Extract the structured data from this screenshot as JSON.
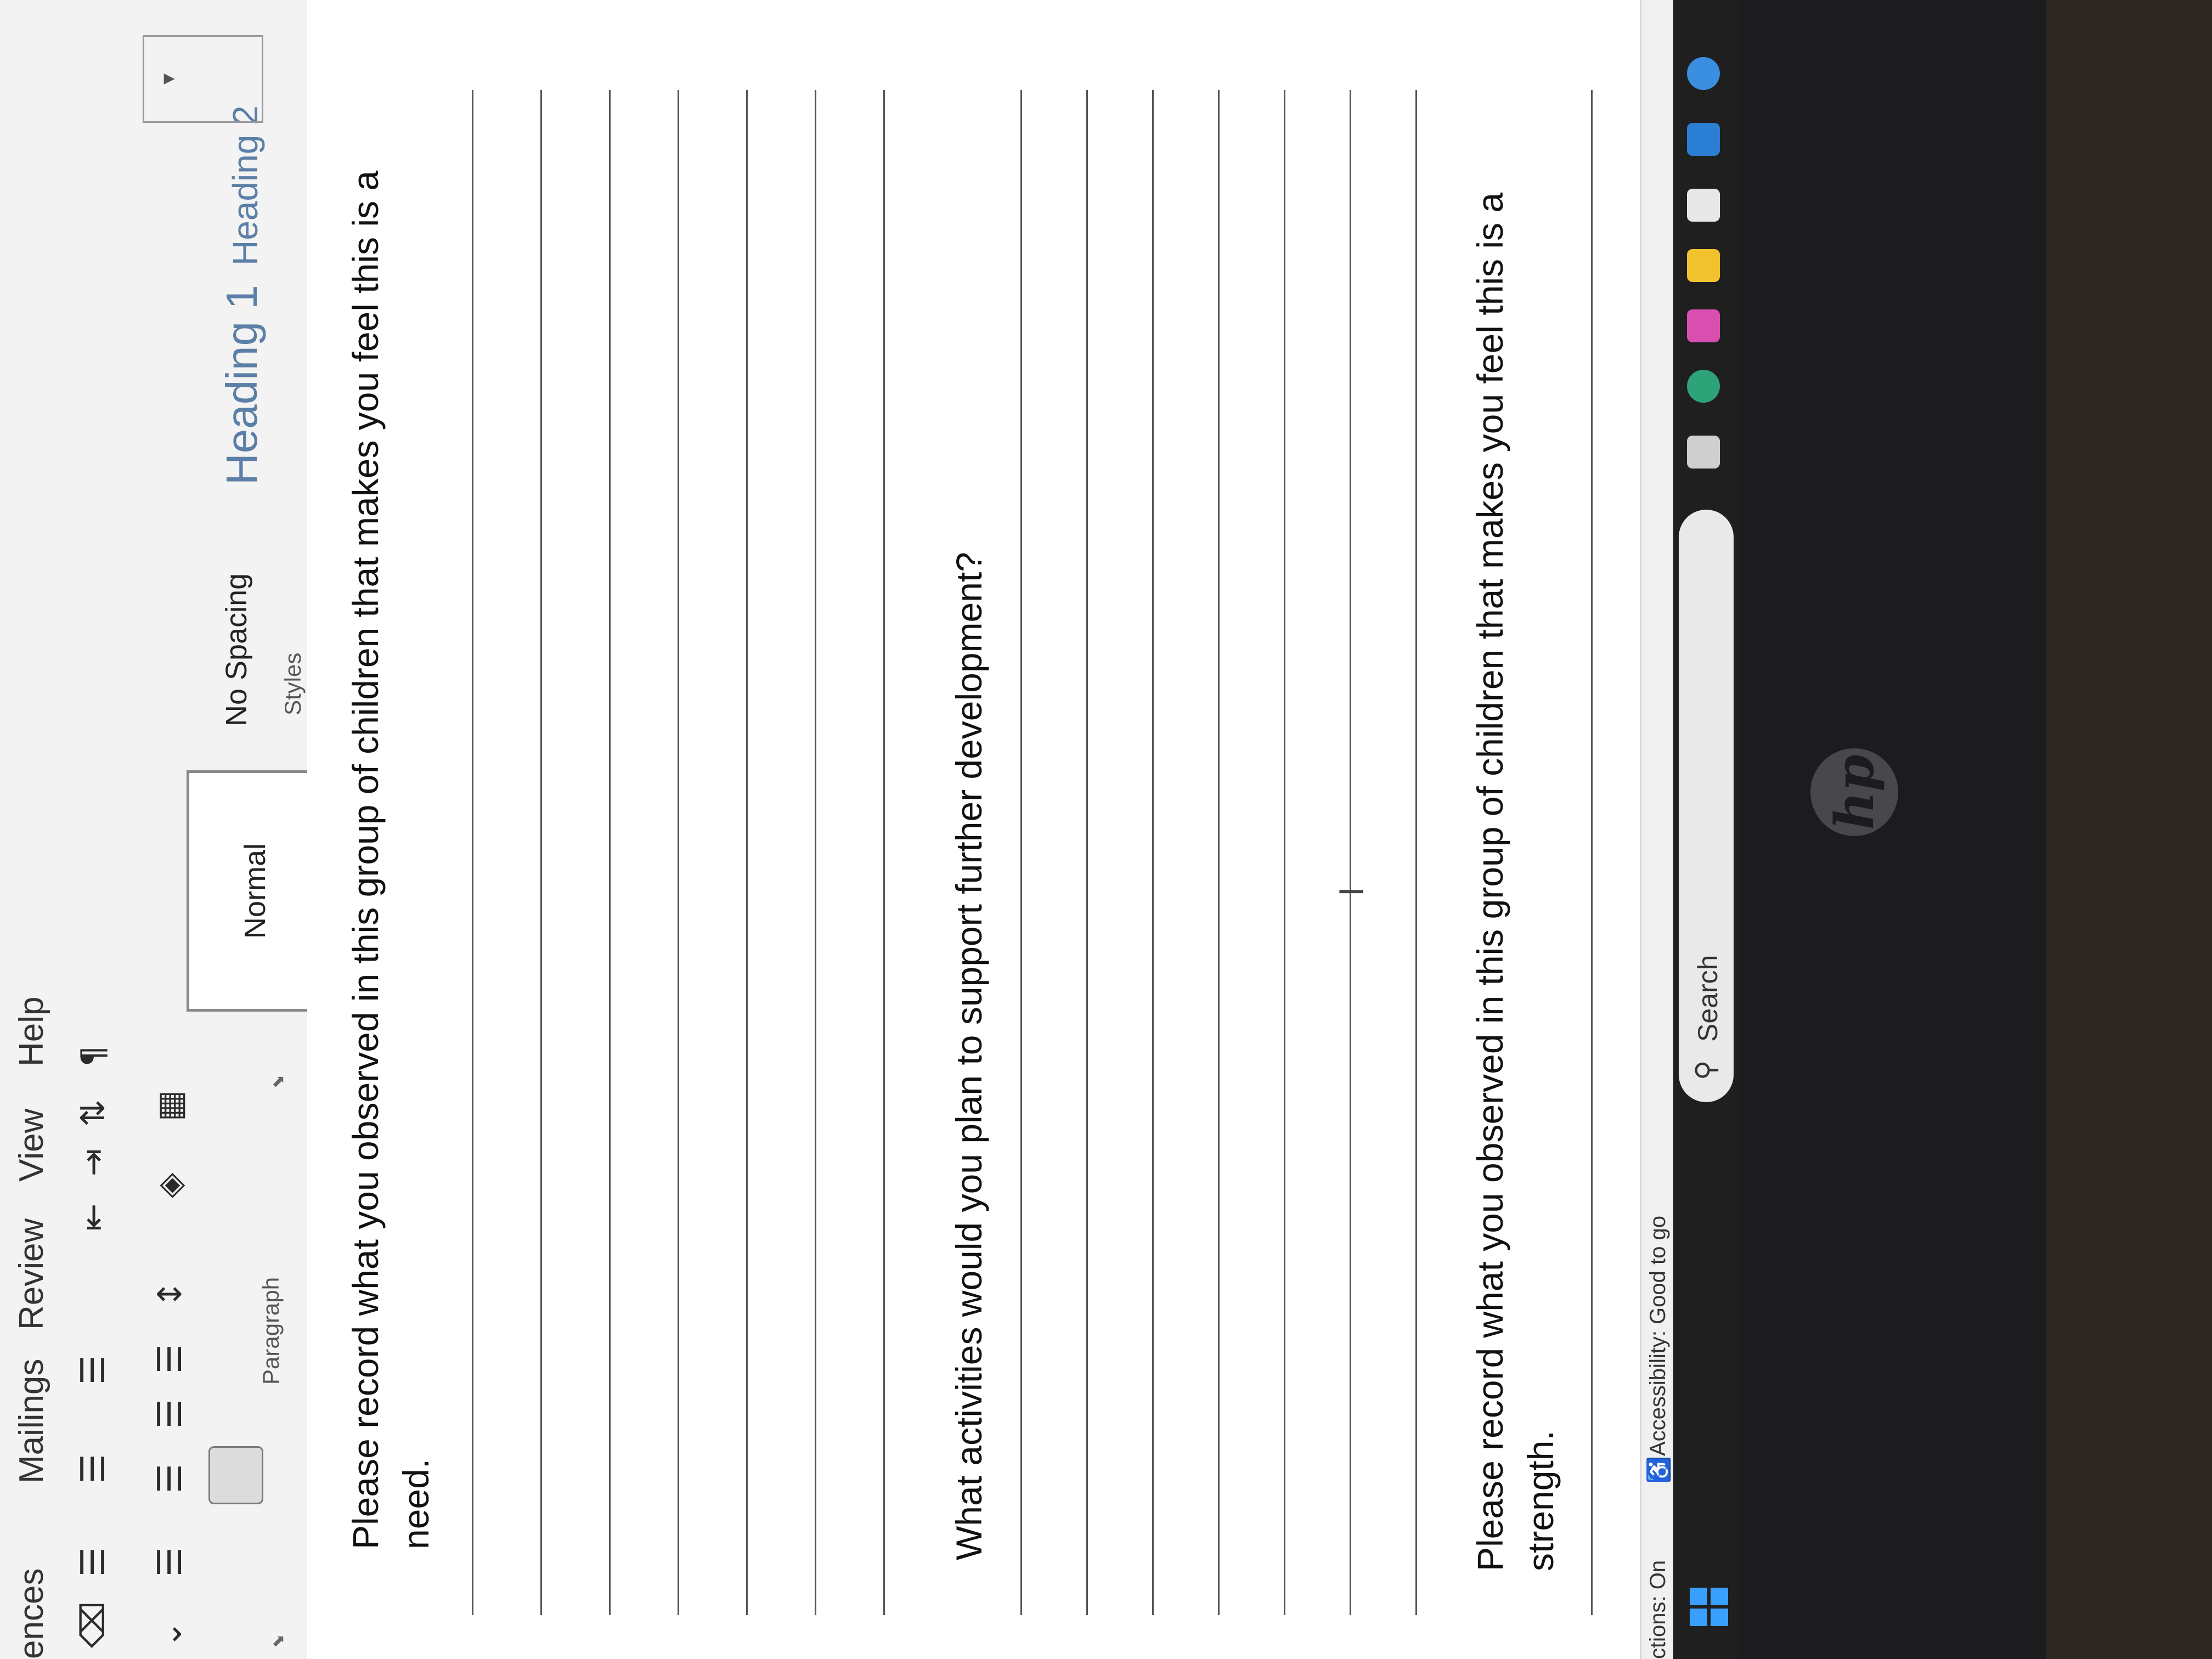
{
  "ribbon": {
    "tabs": [
      "ences",
      "Mailings",
      "Review",
      "View",
      "Help"
    ],
    "groups": {
      "paragraph": "Paragraph",
      "styles": "Styles"
    },
    "styles": {
      "normal": "Normal",
      "no_spacing": "No Spacing",
      "heading1": "Heading 1",
      "heading2": "Heading 2"
    },
    "heading_color": "#5b7fa6"
  },
  "document": {
    "q1_line1": "Please record what you observed in this group of children that makes you feel this is a",
    "q1_line2": "need.",
    "q2": "What activities would you plan to support further development?",
    "q3_line1": "Please record what you observed in this group of children that makes you feel this is a",
    "q3_line2": "strength."
  },
  "status": {
    "predictions": "ctions: On",
    "accessibility": "Accessibility: Good to go"
  },
  "taskbar": {
    "search_label": "Search",
    "accent": "#3aa0ff"
  }
}
